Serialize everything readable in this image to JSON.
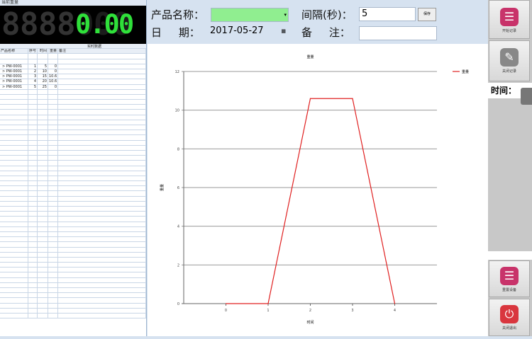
{
  "left": {
    "title": "当前重量",
    "digits": [
      "8",
      "8",
      "8",
      "8",
      "0.",
      "0",
      "0"
    ],
    "display_value": "0.00",
    "section": "实时数据",
    "columns": [
      "产品名称",
      "序号",
      "时间",
      "重量",
      "备注"
    ],
    "rows": [
      [
        "PW-0001",
        "1",
        "5",
        "0",
        ""
      ],
      [
        "PW-0001",
        "2",
        "10",
        "0",
        ""
      ],
      [
        "PW-0001",
        "3",
        "15",
        "10.6",
        ""
      ],
      [
        "PW-0001",
        "4",
        "20",
        "10.6",
        ""
      ],
      [
        "PW-0001",
        "5",
        "25",
        "0",
        ""
      ]
    ]
  },
  "form": {
    "product_label": "产品名称：",
    "product_value": "",
    "interval_label": "间隔(秒)：",
    "interval_value": "5",
    "save_label": "保存",
    "date_label": "日     期：",
    "date_value": "2017-05-27",
    "note_label": "备     注：",
    "note_value": ""
  },
  "right": {
    "start_label": "开始记录",
    "stop_label": "关闭记录",
    "time_label": "时间：",
    "reset_label": "重置设备",
    "exit_label": "关闭退出"
  },
  "colors": {
    "digit_on": "#2fe03a",
    "line": "#e02020",
    "product_field": "#90ee90"
  },
  "chart_data": {
    "type": "line",
    "title": "重量",
    "xlabel": "时间",
    "ylabel": "重量",
    "legend": "top-right",
    "series": [
      {
        "name": "重量",
        "x": [
          0,
          1,
          2,
          3,
          4
        ],
        "values": [
          0,
          0,
          10.6,
          10.6,
          0
        ]
      }
    ],
    "xlim": [
      -1,
      5
    ],
    "ylim": [
      0,
      12
    ],
    "xticks": [
      0,
      1,
      2,
      3,
      4
    ],
    "yticks": [
      0,
      2,
      4,
      6,
      8,
      10,
      12
    ],
    "grid": true
  }
}
